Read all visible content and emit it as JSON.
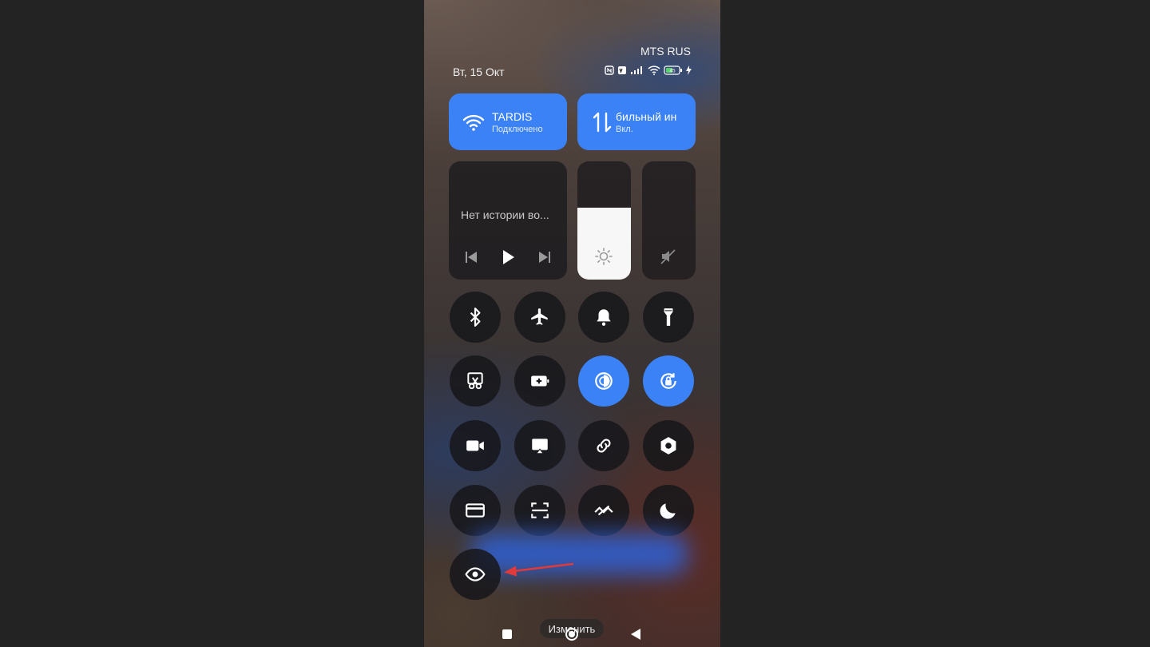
{
  "status": {
    "carrier": "MTS RUS",
    "date": "Вт, 15 Окт",
    "battery": "45"
  },
  "tiles": {
    "wifi": {
      "title": "TARDIS",
      "subtitle": "Подключено"
    },
    "mobile": {
      "title": "бильный ин",
      "subtitle": "Вкл."
    }
  },
  "media": {
    "text": "Нет истории во..."
  },
  "sliders": {
    "brightness_level": 0.61
  },
  "toggles": [
    {
      "id": "bluetooth",
      "icon": "bluetooth-icon",
      "on": false
    },
    {
      "id": "airplane",
      "icon": "airplane-icon",
      "on": false
    },
    {
      "id": "sound",
      "icon": "bell-icon",
      "on": false
    },
    {
      "id": "flashlight",
      "icon": "flashlight-icon",
      "on": false
    },
    {
      "id": "screenshot",
      "icon": "scissors-icon",
      "on": false
    },
    {
      "id": "battery-saver",
      "icon": "battery-plus-icon",
      "on": false
    },
    {
      "id": "reading-mode",
      "icon": "contrast-icon",
      "on": true
    },
    {
      "id": "rotation-lock",
      "icon": "rotation-lock-icon",
      "on": true
    },
    {
      "id": "screen-record",
      "icon": "video-camera-icon",
      "on": false
    },
    {
      "id": "cast",
      "icon": "cast-icon",
      "on": false
    },
    {
      "id": "link",
      "icon": "link-icon",
      "on": false
    },
    {
      "id": "settings",
      "icon": "hexagon-settings-icon",
      "on": false
    },
    {
      "id": "card",
      "icon": "card-icon",
      "on": false
    },
    {
      "id": "scanner",
      "icon": "scan-icon",
      "on": false
    },
    {
      "id": "data-saver",
      "icon": "data-saver-icon",
      "on": false
    },
    {
      "id": "dark-mode",
      "icon": "moon-icon",
      "on": false
    },
    {
      "id": "eye-comfort",
      "icon": "eye-icon",
      "on": false
    }
  ],
  "edit_label": "Изменить",
  "colors": {
    "accent": "#3b82f6",
    "arrow": "#e03a3a"
  }
}
